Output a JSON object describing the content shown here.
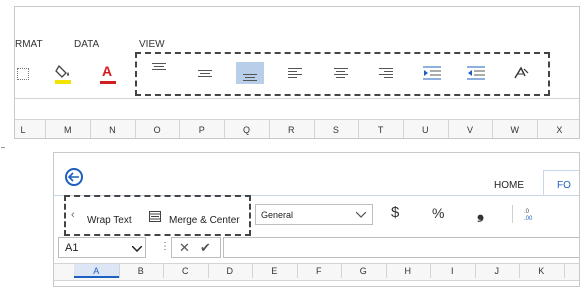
{
  "top_ribbon": {
    "tabs": [
      "FORMAT",
      "DATA",
      "VIEW"
    ],
    "tab_visible_text": [
      "RMAT",
      "DATA",
      "VIEW"
    ],
    "icons": [
      "borders-icon",
      "fill-color-icon",
      "font-color-icon"
    ],
    "font_color_letter": "A",
    "alignment_buttons": [
      {
        "name": "align-top-icon",
        "selected": false
      },
      {
        "name": "align-middle-icon",
        "selected": false
      },
      {
        "name": "align-bottom-icon",
        "selected": true
      },
      {
        "name": "align-left-icon",
        "selected": false
      },
      {
        "name": "align-center-icon",
        "selected": false
      },
      {
        "name": "align-right-icon",
        "selected": false
      },
      {
        "name": "decrease-indent-icon",
        "selected": false
      },
      {
        "name": "increase-indent-icon",
        "selected": false
      },
      {
        "name": "text-orientation-icon",
        "selected": false
      }
    ],
    "columns": [
      "L",
      "M",
      "N",
      "O",
      "P",
      "Q",
      "R",
      "S",
      "T",
      "U",
      "V",
      "W",
      "X"
    ],
    "colors": {
      "fill": "#f2e300",
      "font": "#d11f1f",
      "selected": "#b9cfe9"
    }
  },
  "bottom_ribbon": {
    "tabs": {
      "home": "HOME",
      "next": "FO"
    },
    "wrap_text": "Wrap Text",
    "merge_center": "Merge & Center",
    "number_format": "General",
    "currency_symbol": "$",
    "percent_symbol": "%",
    "comma_symbol": "❟",
    "name_box": "A1",
    "columns": [
      "A",
      "B",
      "C",
      "D",
      "E",
      "F",
      "G",
      "H",
      "I",
      "J",
      "K"
    ],
    "selected_column": "A",
    "colors": {
      "accent": "#1f5fbf",
      "selected_col": "#dce6f4"
    }
  }
}
